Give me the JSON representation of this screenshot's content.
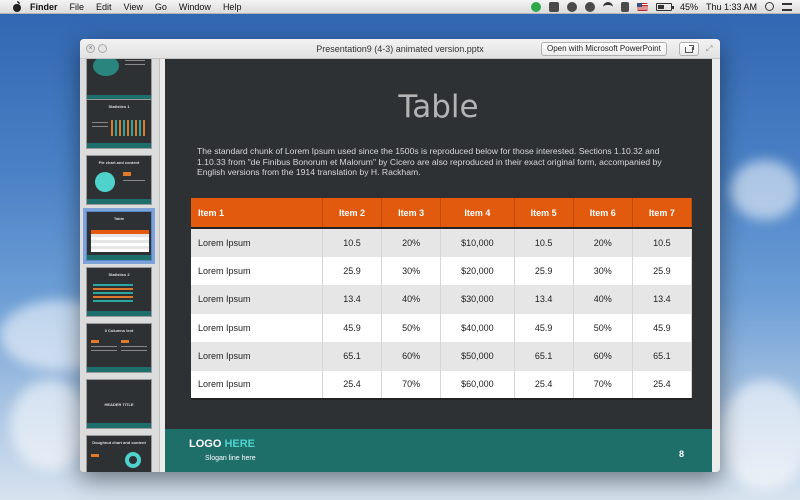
{
  "menubar": {
    "app": "Finder",
    "items": [
      "File",
      "Edit",
      "View",
      "Go",
      "Window",
      "Help"
    ],
    "battery": "45%",
    "clock": "Thu 1:33 AM"
  },
  "window": {
    "title": "Presentation9 (4-3) animated version.pptx",
    "open_button": "Open with Microsoft PowerPoint"
  },
  "sidebar": {
    "thumbs": [
      {
        "title": ""
      },
      {
        "title": "Statistics 1"
      },
      {
        "title": "Pie chart and content"
      },
      {
        "title": "Table"
      },
      {
        "title": "Statistics 2"
      },
      {
        "title": "3 Columns text"
      },
      {
        "title": "HEADER TITLE"
      },
      {
        "title": "Doughnut chart and content"
      }
    ]
  },
  "slide": {
    "title": "Table",
    "body": "The standard chunk of Lorem Ipsum used since the 1500s is reproduced below for those interested. Sections 1.10.32 and 1.10.33 from \"de Finibus Bonorum et Malorum\" by Cicero are also reproduced in their exact original form, accompanied by English versions from the 1914 translation by H. Rackham.",
    "table": {
      "headers": [
        "Item 1",
        "Item 2",
        "Item 3",
        "Item 4",
        "Item 5",
        "Item 6",
        "Item 7"
      ],
      "rows": [
        [
          "Lorem Ipsum",
          "10.5",
          "20%",
          "$10,000",
          "10.5",
          "20%",
          "10.5"
        ],
        [
          "Lorem Ipsum",
          "25.9",
          "30%",
          "$20,000",
          "25.9",
          "30%",
          "25.9"
        ],
        [
          "Lorem Ipsum",
          "13.4",
          "40%",
          "$30,000",
          "13.4",
          "40%",
          "13.4"
        ],
        [
          "Lorem Ipsum",
          "45.9",
          "50%",
          "$40,000",
          "45.9",
          "50%",
          "45.9"
        ],
        [
          "Lorem Ipsum",
          "65.1",
          "60%",
          "$50,000",
          "65.1",
          "60%",
          "65.1"
        ],
        [
          "Lorem Ipsum",
          "25.4",
          "70%",
          "$60,000",
          "25.4",
          "70%",
          "25.4"
        ]
      ]
    },
    "footer": {
      "logo_part1": "LOGO ",
      "logo_part2": "HERE",
      "slogan": "Slogan line here",
      "page_number": "8"
    }
  },
  "colors": {
    "header_orange": "#e15a0d",
    "footer_teal": "#1e6e6a",
    "slide_bg": "#2d3133",
    "logo_accent": "#4fd2cc"
  }
}
